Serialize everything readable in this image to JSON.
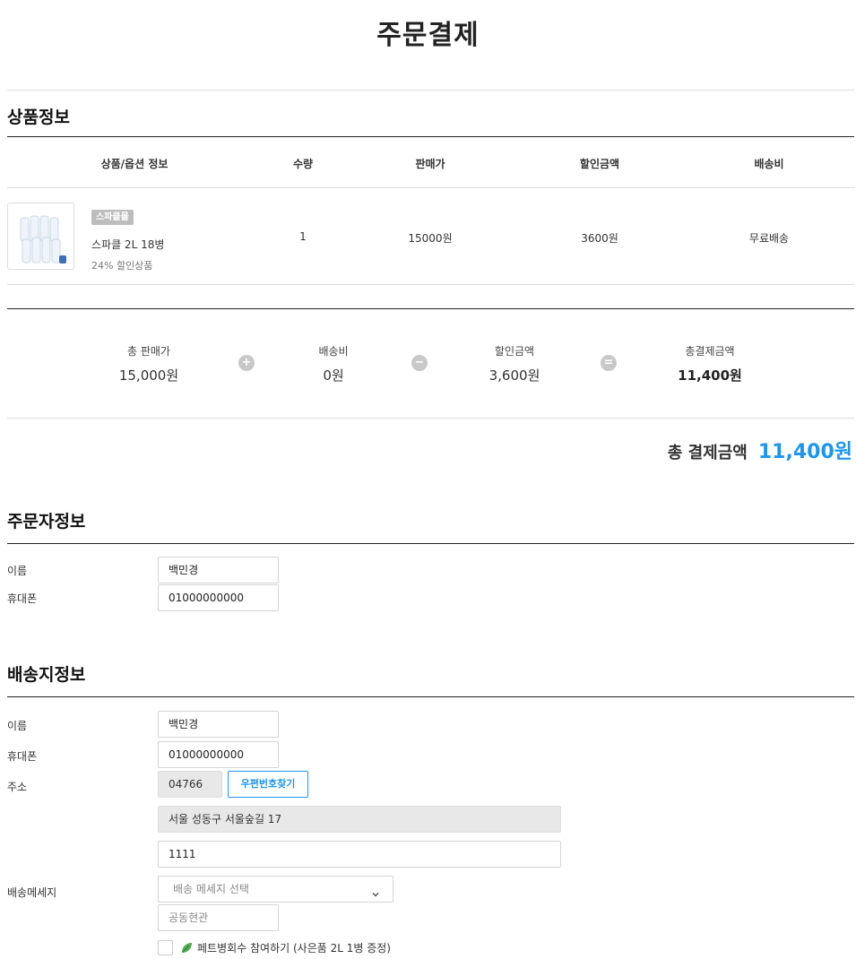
{
  "page": {
    "title": "주문결제"
  },
  "product_section": {
    "title": "상품정보",
    "headers": [
      "상품/옵션 정보",
      "수량",
      "판매가",
      "할인금액",
      "배송비"
    ],
    "item": {
      "badge": "스파클몰",
      "name": "스파클 2L 18병",
      "note": "24% 할인상품",
      "quantity": "1",
      "price": "15000원",
      "discount": "3600원",
      "shipping": "무료배송"
    }
  },
  "summary": {
    "items": [
      {
        "label": "총 판매가",
        "value": "15,000원"
      },
      {
        "label": "배송비",
        "value": "0원"
      },
      {
        "label": "할인금액",
        "value": "3,600원"
      },
      {
        "label": "총결제금액",
        "value": "11,400원"
      }
    ],
    "operators": [
      "+",
      "−",
      "="
    ],
    "total_label": "총 결제금액",
    "total_value": "11,400원"
  },
  "orderer_section": {
    "title": "주문자정보",
    "name_label": "이름",
    "name_value": "백민경",
    "phone_label": "휴대폰",
    "phone_value": "01000000000"
  },
  "shipping_section": {
    "title": "배송지정보",
    "name_label": "이름",
    "name_value": "백민경",
    "phone_label": "휴대폰",
    "phone_value": "01000000000",
    "address_label": "주소",
    "zipcode": "04766",
    "zip_button": "우편번호찾기",
    "address1": "서울 성동구 서울숲길 17",
    "address2": "1111",
    "message_label": "배송메세지",
    "message_select": "배송 메세지 선택",
    "door_placeholder": "공동현관",
    "pet_checkbox_label": "페트병회수 참여하기 (사은품 2L 1병 증정)"
  },
  "colors": {
    "accent": "#1e96f0",
    "badge": "#bdbdbd",
    "operator": "#c8c8c8"
  },
  "icons": {
    "select_arrow": "chevron-down-icon",
    "leaf": "leaf-icon",
    "product": "water-bottles-image"
  }
}
